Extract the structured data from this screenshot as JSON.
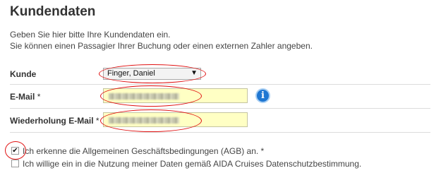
{
  "section": {
    "title": "Kundendaten",
    "intro_line1": "Geben Sie hier bitte Ihre Kundendaten ein.",
    "intro_line2": "Sie können einen Passagier Ihrer Buchung oder einen externen Zahler angeben."
  },
  "form": {
    "customer_label": "Kunde",
    "customer_value": "Finger, Daniel",
    "email_label": "E-Mail",
    "email_confirm_label": "Wiederholung E-Mail",
    "required_marker": "*",
    "email_value": "",
    "email_confirm_value": ""
  },
  "consent": {
    "agb_label": "Ich erkenne die Allgemeinen Geschäftsbedingungen (AGB) an. *",
    "agb_checked": true,
    "privacy_label": "Ich willige ein in die Nutzung meiner Daten gemäß AIDA Cruises Datenschutzbestimmung.",
    "privacy_checked": false
  },
  "colors": {
    "input_background": "#ffffc4",
    "info_icon": "#1f77d2",
    "annotation_ring": "#e01010"
  },
  "icons": {
    "info": "info-icon",
    "dropdown": "chevron-down-icon",
    "checkmark": "check-icon"
  }
}
